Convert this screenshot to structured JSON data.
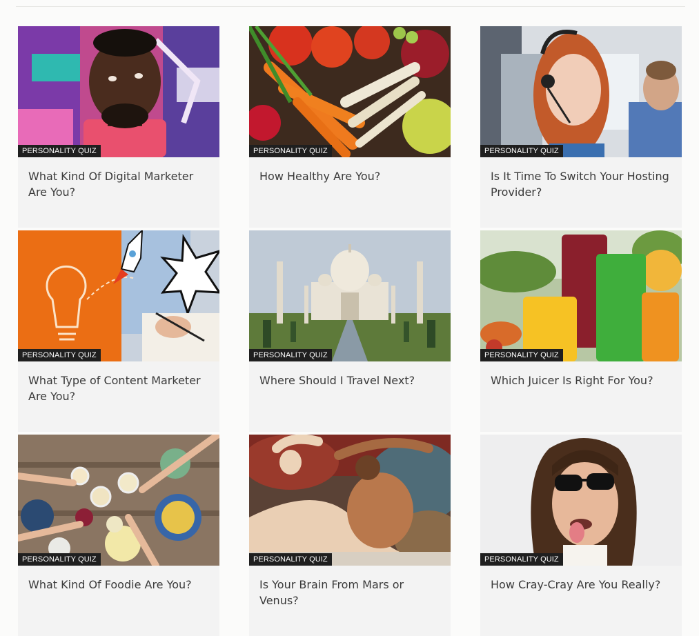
{
  "quizzes": [
    {
      "badge": "PERSONALITY QUIZ",
      "title": "What Kind Of Digital Marketer Are You?",
      "image": "man-graffiti-wall-photo"
    },
    {
      "badge": "PERSONALITY QUIZ",
      "title": "How Healthy Are You?",
      "image": "vegetables-photo"
    },
    {
      "badge": "PERSONALITY QUIZ",
      "title": "Is It Time To Switch Your Hosting Provider?",
      "image": "headset-support-agent-photo"
    },
    {
      "badge": "PERSONALITY QUIZ",
      "title": "What Type of Content Marketer Are You?",
      "image": "rocket-lightbulb-writing-photo"
    },
    {
      "badge": "PERSONALITY QUIZ",
      "title": "Where Should I Travel Next?",
      "image": "taj-mahal-photo"
    },
    {
      "badge": "PERSONALITY QUIZ",
      "title": "Which Juicer Is Right For You?",
      "image": "juice-glasses-photo"
    },
    {
      "badge": "PERSONALITY QUIZ",
      "title": "What Kind Of Foodie Are You?",
      "image": "dinner-table-toast-photo"
    },
    {
      "badge": "PERSONALITY QUIZ",
      "title": "Is Your Brain From Mars or Venus?",
      "image": "mars-venus-painting"
    },
    {
      "badge": "PERSONALITY QUIZ",
      "title": "How Cray-Cray Are You Really?",
      "image": "sunglasses-tongue-man-photo"
    }
  ],
  "colors": {
    "page_background": "#fbfbfa",
    "card_background": "#f3f3f3",
    "badge_background": "#1f1f1f",
    "badge_text": "#ffffff",
    "title_text": "#3a3a3a"
  }
}
